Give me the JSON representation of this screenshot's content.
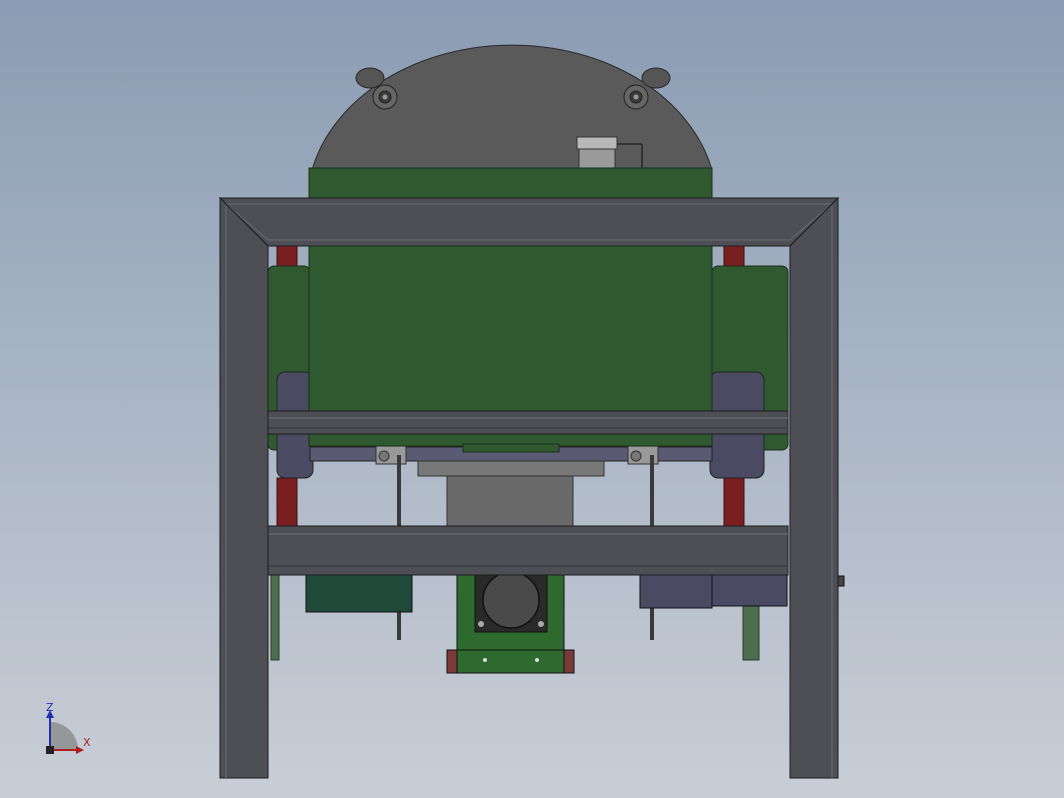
{
  "viewport": {
    "background_top": "#8a9cb3",
    "background_bottom": "#c9ced6"
  },
  "model": {
    "dome_color": "#5a5a5a",
    "frame_color": "#4e4e55",
    "housing_color": "#2f5a2f",
    "post_color": "#7a1f1f",
    "bracket_color": "#4a4a62",
    "motor_color": "#1f4a3a",
    "gearbox_plate_color": "#2e6a2e"
  },
  "triad": {
    "z_label": "Z",
    "x_label": "X",
    "z_color": "#1f2fb0",
    "x_color": "#b01f1f"
  }
}
